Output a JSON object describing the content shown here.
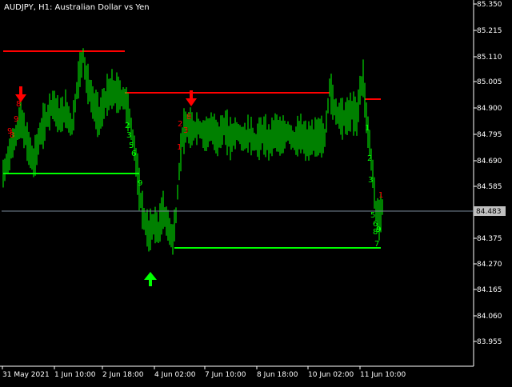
{
  "header": {
    "title": "AUDJPY, H1:  Australian Dollar vs Yen"
  },
  "chart_data": {
    "type": "bar",
    "title": "AUDJPY, H1:  Australian Dollar vs Yen",
    "symbol": "AUDJPY",
    "timeframe": "H1",
    "instrument_name": "Australian Dollar vs Yen",
    "ylim": [
      83.86,
      85.36
    ],
    "y_ticks": [
      "85.350",
      "85.215",
      "85.110",
      "85.005",
      "84.900",
      "84.795",
      "84.690",
      "84.585",
      "84.480",
      "84.375",
      "84.270",
      "84.165",
      "84.060",
      "83.955"
    ],
    "x_ticks": [
      "31 May 2021",
      "1 Jun 10:00",
      "2 Jun 18:00",
      "4 Jun 02:00",
      "7 Jun 10:00",
      "8 Jun 18:00",
      "10 Jun 02:00",
      "11 Jun 10:00"
    ],
    "current_price": "84.483",
    "grid": false,
    "background": "#000000",
    "bar_color": "#00ff00",
    "resistance_color": "#ff0000",
    "support_color": "#00ff00",
    "arrow_up_color": "#00ff00",
    "arrow_down_color": "#ff0000",
    "price_line_color": "#778899",
    "counter_labels": {
      "red": [
        "8",
        "9",
        "9",
        "8",
        "1",
        "2",
        "3",
        "8",
        "1"
      ],
      "green": [
        "2",
        "3",
        "5",
        "6",
        "9",
        "1",
        "2",
        "3",
        "5",
        "6",
        "7",
        "8",
        "9"
      ]
    }
  }
}
